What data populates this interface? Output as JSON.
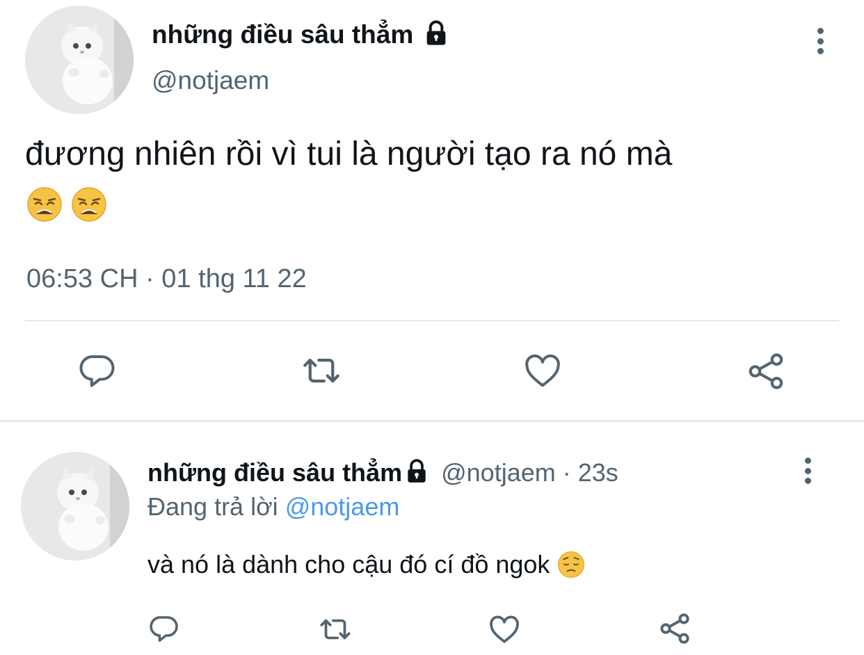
{
  "main_tweet": {
    "display_name": "những điều sâu thẳm",
    "handle": "@notjaem",
    "text": "đương nhiên rồi vì tui là người tạo ra nó mà",
    "emojis": [
      "weary-face-emoji",
      "weary-face-emoji"
    ],
    "timestamp": "06:53 CH · 01 thg 11 22",
    "protected": true
  },
  "reply_tweet": {
    "display_name": "những điều sâu thẳm",
    "handle": "@notjaem",
    "time_ago": "· 23s",
    "replying_prefix": "Đang trả lời",
    "replying_to": "@notjaem",
    "text": "và nó là dành cho cậu đó cí đồ ngok",
    "emoji": "pensive-face-emoji",
    "protected": true
  },
  "actions": [
    "reply-icon",
    "retweet-icon",
    "like-icon",
    "share-icon"
  ],
  "colors": {
    "text": "#0f1419",
    "secondary": "#536471",
    "link": "#4a99e9",
    "divider": "#e6e9eb"
  }
}
